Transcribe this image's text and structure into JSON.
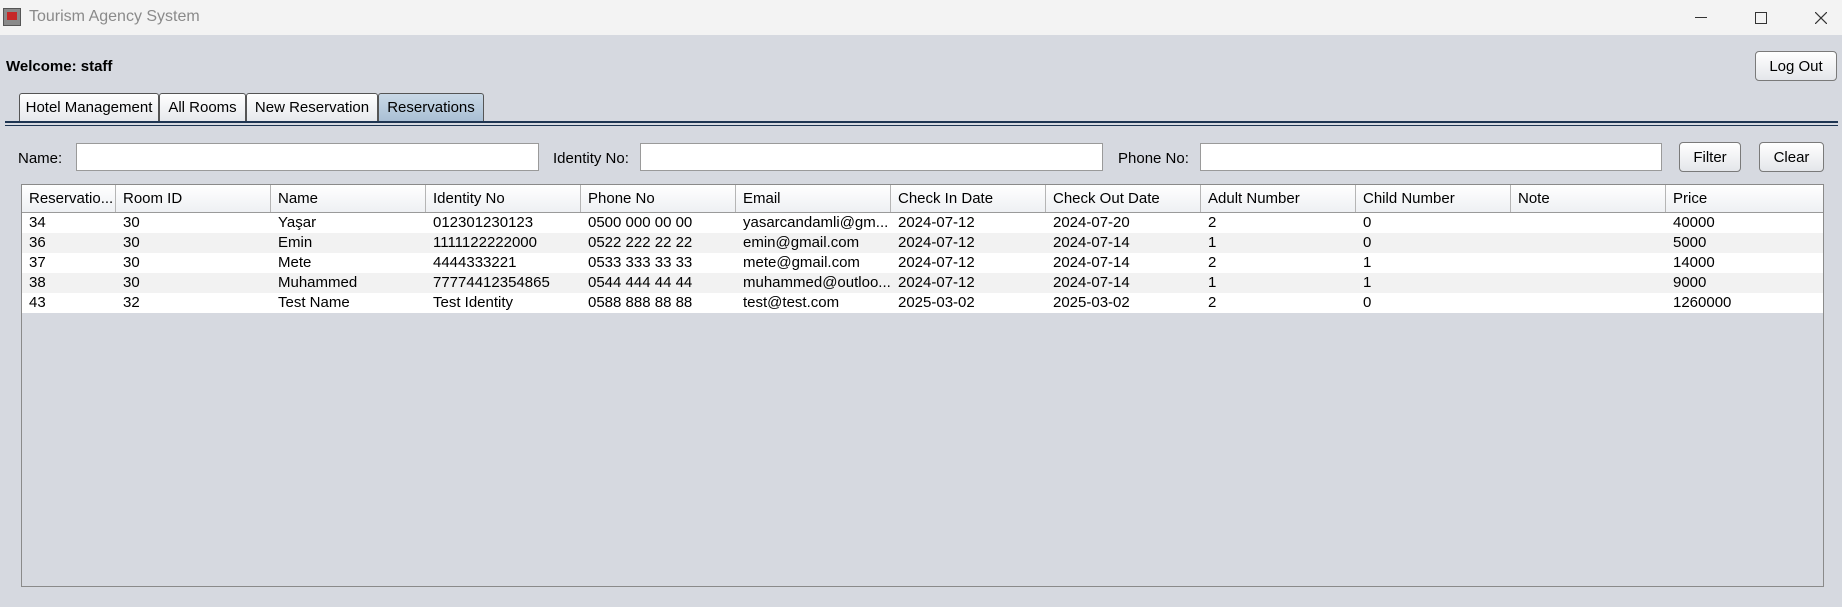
{
  "window": {
    "title": "Tourism Agency System"
  },
  "header": {
    "welcome": "Welcome: staff",
    "logout_label": "Log Out"
  },
  "tabs": [
    {
      "label": "Hotel Management",
      "active": false
    },
    {
      "label": "All Rooms",
      "active": false
    },
    {
      "label": "New Reservation",
      "active": false
    },
    {
      "label": "Reservations",
      "active": true
    }
  ],
  "filters": {
    "name_label": "Name:",
    "name_value": "",
    "identity_label": "Identity No:",
    "identity_value": "",
    "phone_label": "Phone No:",
    "phone_value": "",
    "filter_label": "Filter",
    "clear_label": "Clear"
  },
  "table": {
    "columns": [
      "Reservatio...",
      "Room ID",
      "Name",
      "Identity No",
      "Phone No",
      "Email",
      "Check In Date",
      "Check Out Date",
      "Adult Number",
      "Child Number",
      "Note",
      "Price"
    ],
    "rows": [
      [
        "34",
        "30",
        "Yaşar",
        "012301230123",
        "0500 000 00 00",
        "yasarcandamli@gm...",
        "2024-07-12",
        "2024-07-20",
        "2",
        "0",
        "",
        "40000"
      ],
      [
        "36",
        "30",
        "Emin",
        "1111122222000",
        "0522 222 22 22",
        "emin@gmail.com",
        "2024-07-12",
        "2024-07-14",
        "1",
        "0",
        "",
        "5000"
      ],
      [
        "37",
        "30",
        "Mete",
        "4444333221",
        "0533 333 33 33",
        "mete@gmail.com",
        "2024-07-12",
        "2024-07-14",
        "2",
        "1",
        "",
        "14000"
      ],
      [
        "38",
        "30",
        "Muhammed",
        "77774412354865",
        "0544 444 44 44",
        "muhammed@outloo...",
        "2024-07-12",
        "2024-07-14",
        "1",
        "1",
        "",
        "9000"
      ],
      [
        "43",
        "32",
        "Test Name",
        "Test Identity",
        "0588 888 88 88",
        "test@test.com",
        "2025-03-02",
        "2025-03-02",
        "2",
        "0",
        "",
        "1260000"
      ]
    ]
  },
  "icons": {
    "app": "app-icon",
    "minimize": "minimize-icon",
    "maximize": "maximize-icon",
    "close": "close-icon"
  },
  "colors": {
    "background": "#d6d9e0",
    "active_tab": "#b8cbdd",
    "tab_line": "#1e3552"
  }
}
